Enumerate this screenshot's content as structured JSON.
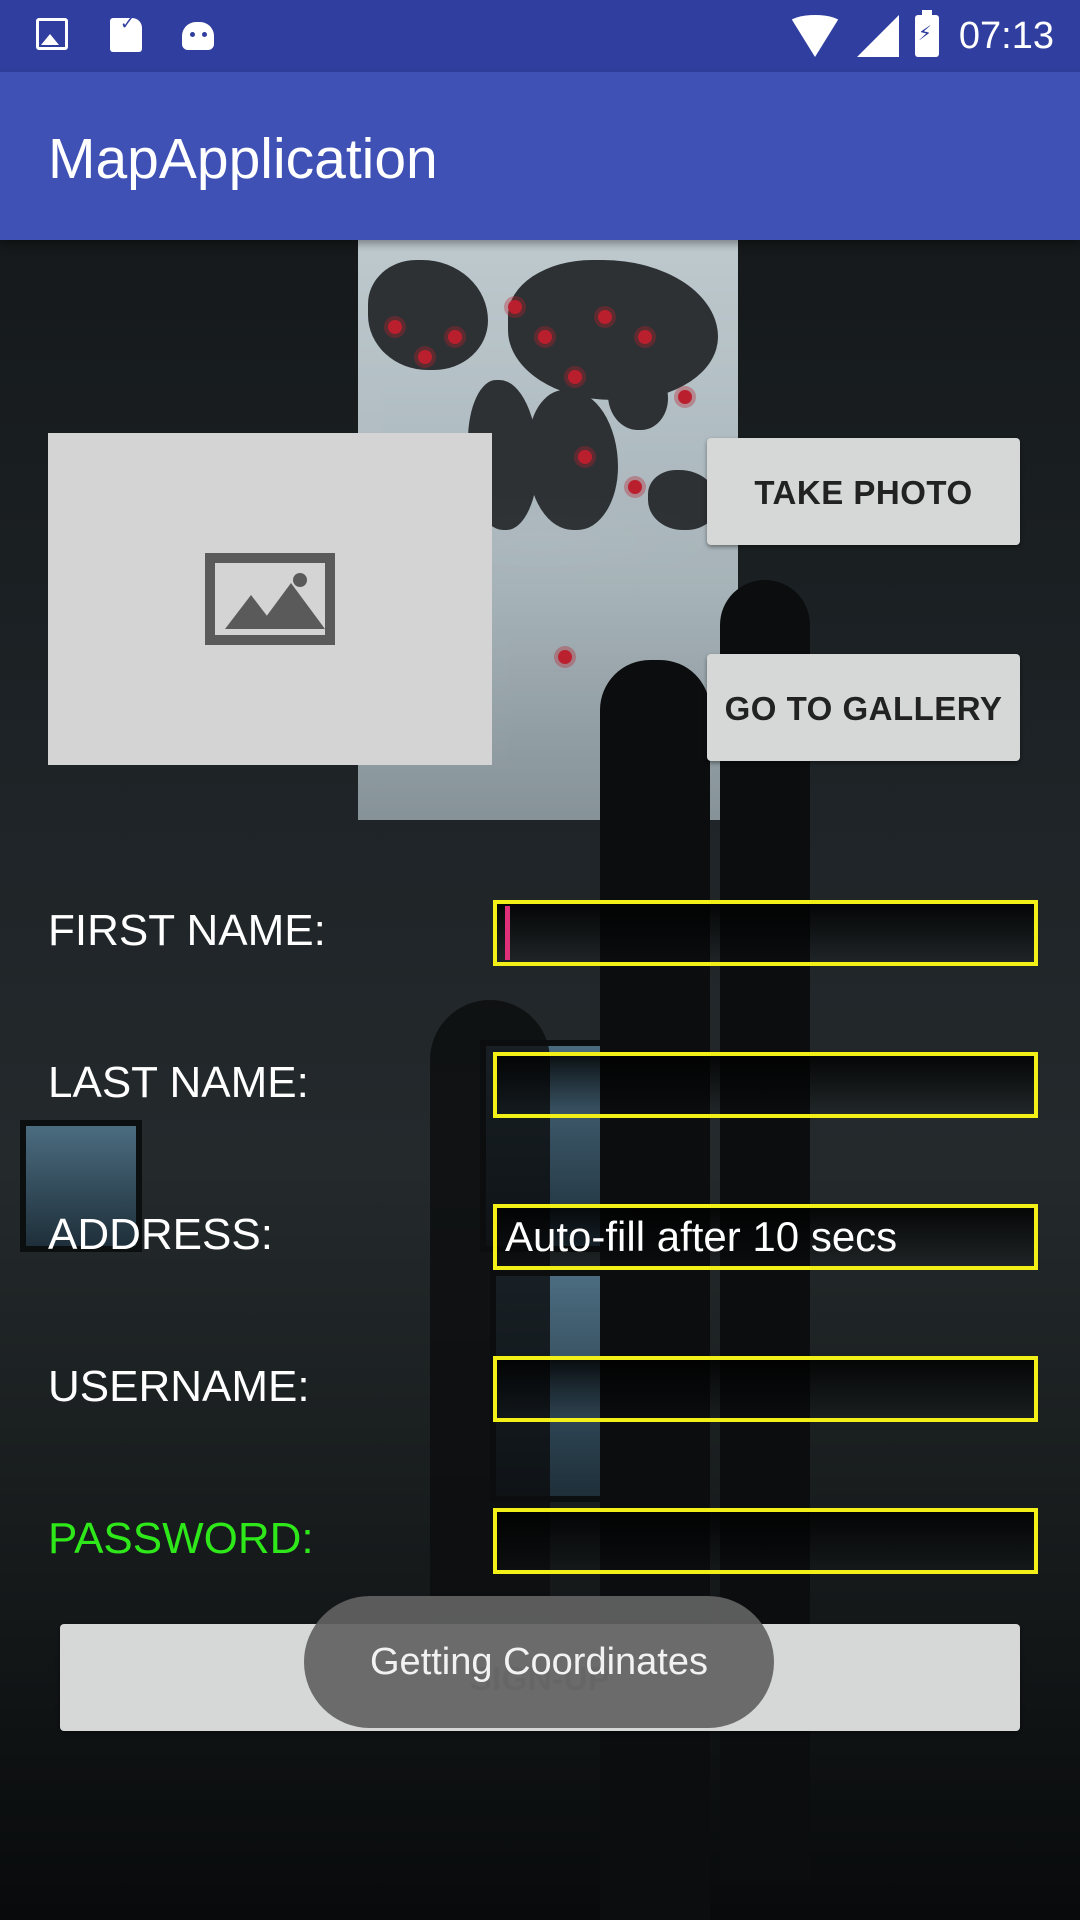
{
  "status_bar": {
    "time": "07:13",
    "left_icons": [
      "image-icon",
      "sd-card-icon",
      "android-icon"
    ],
    "right_icons": [
      "wifi-icon",
      "signal-icon",
      "battery-charging-icon"
    ],
    "color": "#303F9F"
  },
  "app_bar": {
    "title": "MapApplication",
    "color": "#3F51B5"
  },
  "photo": {
    "placeholder_icon": "image-placeholder-icon"
  },
  "buttons": {
    "take_photo": "TAKE PHOTO",
    "go_to_gallery": "GO TO GALLERY",
    "sign_up": "SIGN-UP"
  },
  "form": {
    "first_name_label": "FIRST NAME:",
    "last_name_label": "LAST NAME:",
    "address_label": "ADDRESS:",
    "address_placeholder": "Auto-fill after 10 secs",
    "username_label": "USERNAME:",
    "password_label": "PASSWORD:",
    "field_border_color": "#f3f017",
    "password_label_color": "#2ee81a"
  },
  "toast": {
    "message": "Getting Coordinates"
  }
}
